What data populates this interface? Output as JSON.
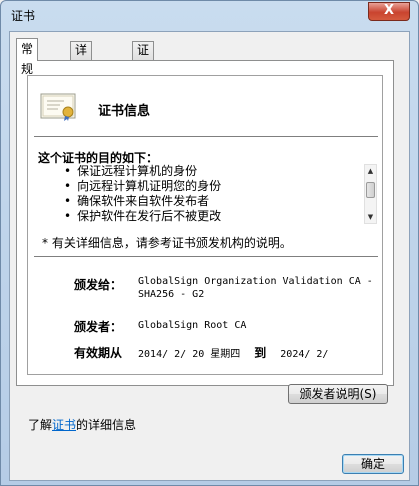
{
  "window": {
    "title": "证书",
    "close_label": "X"
  },
  "tabs": [
    {
      "label": "常规",
      "active": true
    },
    {
      "label": "详细信息",
      "active": false
    },
    {
      "label": "证书路径",
      "active": false
    }
  ],
  "info": {
    "title": "证书信息",
    "purpose_title": "这个证书的目的如下：",
    "purposes": [
      "保证远程计算机的身份",
      "向远程计算机证明您的身份",
      "确保软件来自软件发布者",
      "保护软件在发行后不被更改"
    ],
    "note": "* 有关详细信息，请参考证书颁发机构的说明。",
    "issued_to_label": "颁发给：",
    "issued_to_value": "GlobalSign Organization Validation CA -\nSHA256 - G2",
    "issued_by_label": "颁发者：",
    "issued_by_value": "GlobalSign Root CA",
    "validity_label": "有效期从",
    "valid_from": "2014/  2/  20   星期四",
    "to_label": "到",
    "valid_to": "2024/  2/"
  },
  "buttons": {
    "issuer_statement": "颁发者说明(S)",
    "ok": "确定"
  },
  "footer": {
    "learn_prefix": "了解",
    "learn_link": "证书",
    "learn_suffix": "的详细信息"
  },
  "colors": {
    "link": "#0066cc",
    "title_gradient_top": "#c9dcef"
  },
  "icons": {
    "certificate": "certificate-icon",
    "close": "close-icon"
  }
}
